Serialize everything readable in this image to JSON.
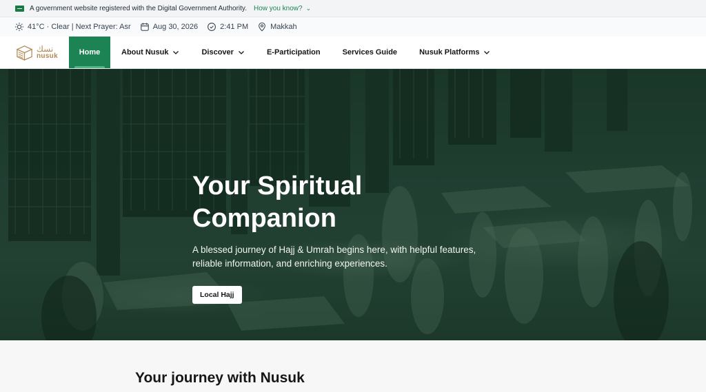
{
  "gov_banner": {
    "text": "A government website registered with the Digital Government Authority.",
    "link_label": "How you know?"
  },
  "info_bar": {
    "weather": "41°C · Clear | Next Prayer: Asr",
    "date": "Aug 30, 2026",
    "time": "2:41 PM",
    "location": "Makkah"
  },
  "logo": {
    "arabic": "نسك",
    "english": "nusuk"
  },
  "nav": {
    "items": [
      {
        "label": "Home",
        "active": true
      },
      {
        "label": "About Nusuk",
        "dropdown": true
      },
      {
        "label": "Discover",
        "dropdown": true
      },
      {
        "label": "E-Participation"
      },
      {
        "label": "Services Guide"
      },
      {
        "label": "Nusuk Platforms",
        "dropdown": true
      }
    ]
  },
  "hero": {
    "title": "Your Spiritual Companion",
    "subtitle": "A blessed journey of Hajj & Umrah begins here, with helpful features, reliable information, and enriching experiences.",
    "button_label": "Local Hajj"
  },
  "section": {
    "title": "Your journey with Nusuk"
  },
  "colors": {
    "primary": "#1b8354",
    "logo_gold": "#b08a55",
    "hero_tint": "#1f3a2b"
  }
}
